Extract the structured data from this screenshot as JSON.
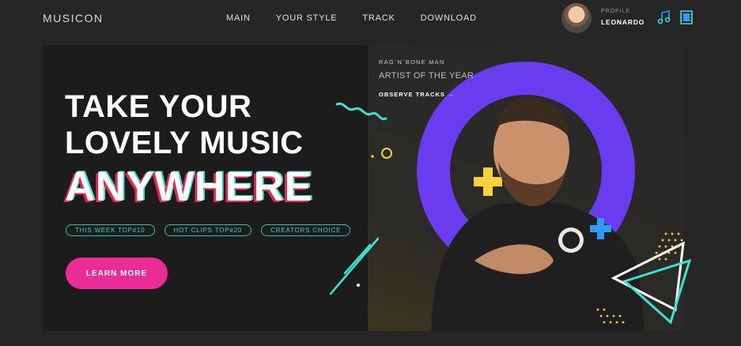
{
  "app": {
    "logo": "MUSICON"
  },
  "nav": {
    "items": [
      "MAIN",
      "YOUR STYLE",
      "TRACK",
      "DOWNLOAD"
    ]
  },
  "profile": {
    "caption": "PROFILE",
    "name": "LEONARDO"
  },
  "header_icons": [
    "music-note-icon",
    "film-icon"
  ],
  "hero": {
    "line1": "TAKE YOUR",
    "line2": "LOVELY MUSIC",
    "line3": "ANYWHERE",
    "tags": [
      "THIS WEEK TOP#10",
      "HOT CLIPS TOP#20",
      "CREATORS CHOICE"
    ],
    "cta_label": "LEARN MORE"
  },
  "artist": {
    "caption": "RAG`N`BONE MAN",
    "title": "ARTIST OF THE YEAR",
    "link": "OBSERVE TRACKS →"
  },
  "colors": {
    "accent_pink": "#ea2c97",
    "accent_teal": "#40e0d0",
    "accent_purple": "#6a3cf0",
    "accent_yellow": "#f6d33c",
    "accent_blue": "#2f9bff"
  }
}
